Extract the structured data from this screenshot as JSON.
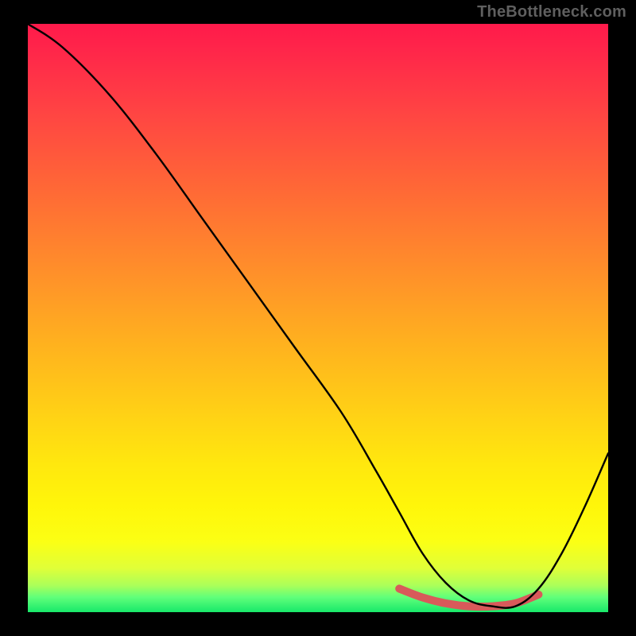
{
  "watermark": "TheBottleneck.com",
  "chart_data": {
    "type": "line",
    "title": "",
    "xlabel": "",
    "ylabel": "",
    "xlim": [
      0,
      100
    ],
    "ylim": [
      0,
      100
    ],
    "grid": false,
    "legend": false,
    "background_gradient": {
      "top": "#ff1a4b",
      "bottom": "#18e86a",
      "description": "vertical red→orange→yellow→green"
    },
    "series": [
      {
        "name": "bottleneck-curve",
        "color": "#000000",
        "x": [
          0,
          6,
          14,
          22,
          30,
          38,
          46,
          54,
          60,
          64,
          68,
          72,
          76,
          80,
          84,
          88,
          92,
          96,
          100
        ],
        "values": [
          100,
          96,
          88,
          78,
          67,
          56,
          45,
          34,
          24,
          17,
          10,
          5,
          2,
          1,
          1,
          4,
          10,
          18,
          27
        ]
      },
      {
        "name": "optimal-range-marker",
        "color": "#d85a5a",
        "x": [
          64,
          68,
          72,
          76,
          80,
          84,
          88
        ],
        "values": [
          4,
          2.5,
          1.5,
          1,
          1,
          1.5,
          3
        ]
      }
    ]
  }
}
